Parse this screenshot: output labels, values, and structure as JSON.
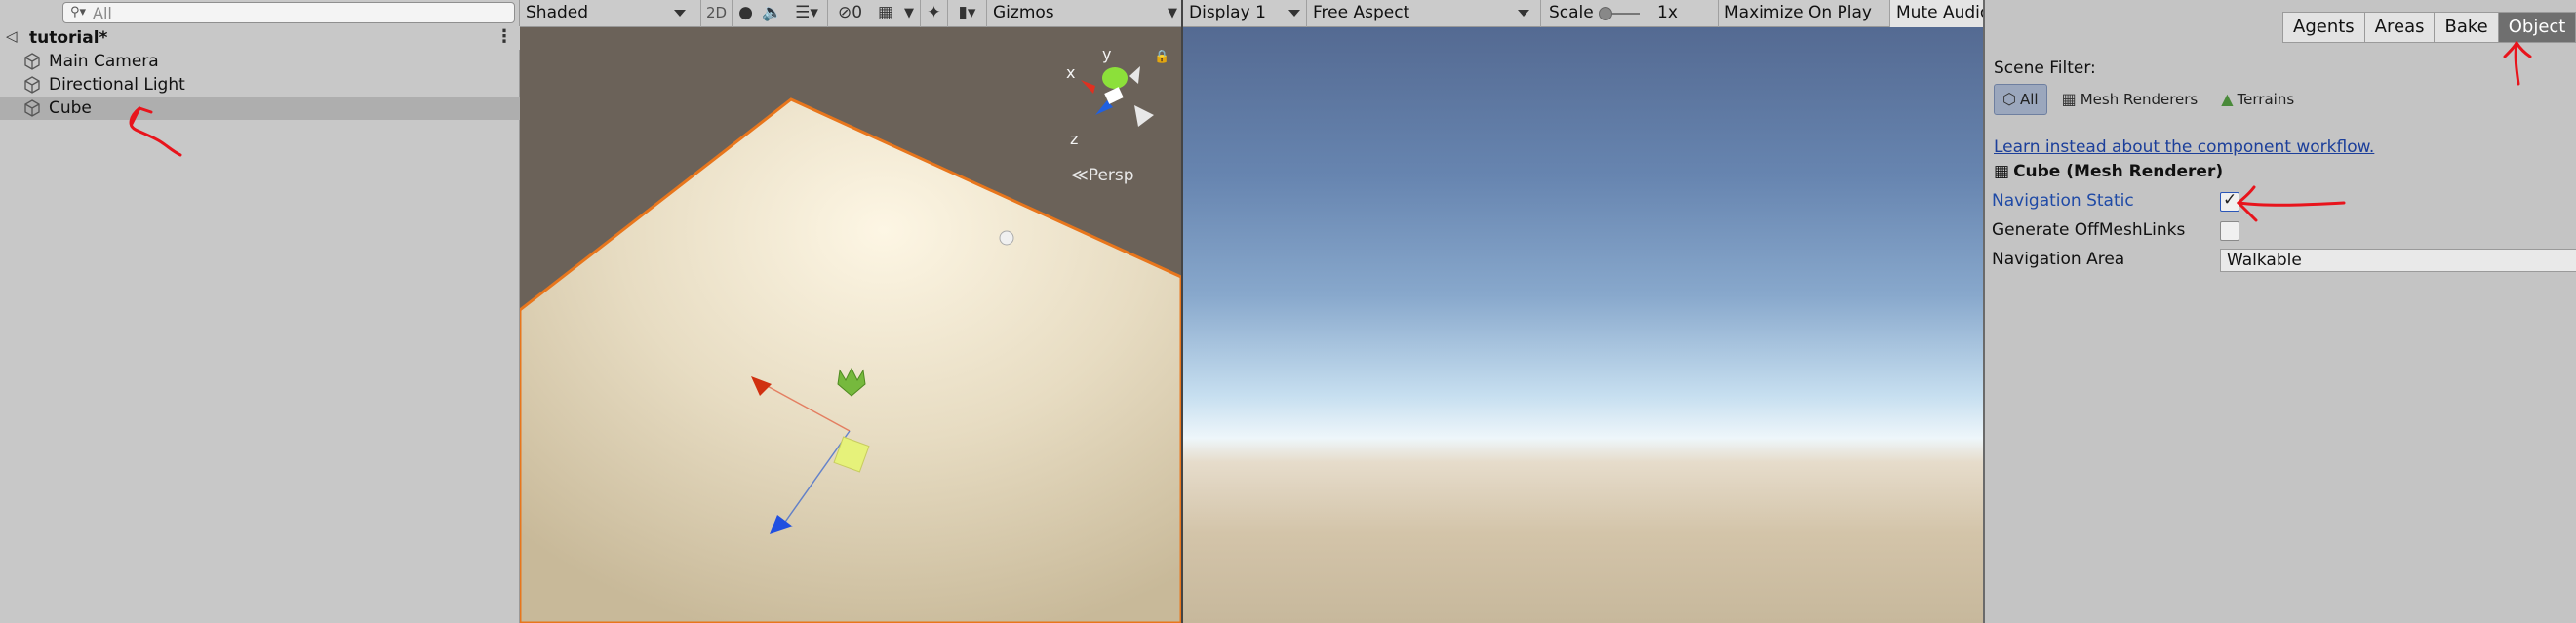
{
  "hierarchy": {
    "search_placeholder": "All",
    "scene_name": "tutorial*",
    "items": [
      {
        "label": "Main Camera"
      },
      {
        "label": "Directional Light"
      },
      {
        "label": "Cube"
      }
    ]
  },
  "scene_toolbar": {
    "shading_mode": "Shaded",
    "mode_2d": "2D",
    "hidden_count": "0",
    "gizmos": "Gizmos"
  },
  "scene_gizmo": {
    "axis_y": "y",
    "axis_x": "x",
    "axis_z": "z",
    "projection": "Persp"
  },
  "game_toolbar": {
    "display": "Display 1",
    "aspect": "Free Aspect",
    "scale_label": "Scale",
    "scale_value": "1x",
    "maximize": "Maximize On Play",
    "mute": "Mute Audio"
  },
  "navigation": {
    "tabs": [
      "Agents",
      "Areas",
      "Bake",
      "Object"
    ],
    "active_tab": "Object",
    "scene_filter_label": "Scene Filter:",
    "filters": [
      "All",
      "Mesh Renderers",
      "Terrains"
    ],
    "learn_link": "Learn instead about the component workflow.",
    "component_title": "Cube (Mesh Renderer)",
    "properties": {
      "navigation_static": {
        "label": "Navigation Static",
        "checked": true
      },
      "generate_offmesh": {
        "label": "Generate OffMeshLinks",
        "checked": false
      },
      "navigation_area": {
        "label": "Navigation Area",
        "value": "Walkable"
      }
    }
  },
  "colors": {
    "selection": "#aeaeae",
    "active_tab": "#6f6f6f",
    "link": "#1c3f9a",
    "annotation": "#e8141c",
    "selection_outline": "#e8761c"
  }
}
